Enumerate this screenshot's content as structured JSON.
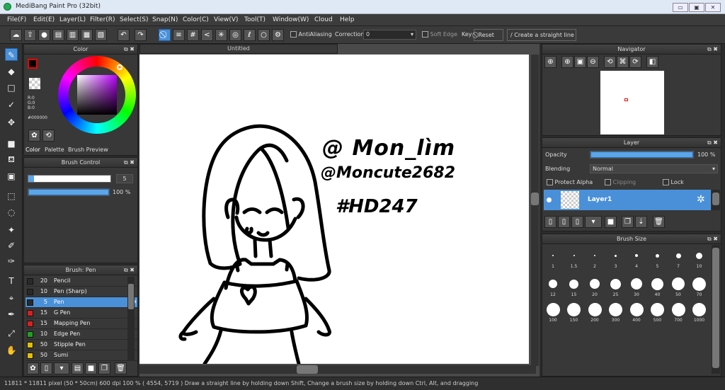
{
  "window": {
    "title": "MediBang Paint Pro (32bit)"
  },
  "menu": [
    "File(F)",
    "Edit(E)",
    "Layer(L)",
    "Filter(R)",
    "Select(S)",
    "Snap(N)",
    "Color(C)",
    "View(V)",
    "Tool(T)",
    "Window(W)",
    "Cloud",
    "Help"
  ],
  "toolbar": {
    "antialiasing": "AntiAliasing",
    "correction_label": "Correction",
    "correction_value": "0",
    "soft_edge": "Soft Edge",
    "key": "Key",
    "reset": "Reset",
    "straight_line": "Create a straight line"
  },
  "color_panel": {
    "title": "Color",
    "r": "R:0",
    "g": "G:0",
    "b": "B:0",
    "hex": "#000000",
    "tabs": [
      "Color",
      "Palette",
      "Brush Preview"
    ],
    "fg_color": "#000000",
    "accent": "#4a90d9"
  },
  "brush_control": {
    "title": "Brush Control",
    "size": "5",
    "opacity": "100 %",
    "opacity_fraction": 1.0
  },
  "brush_panel": {
    "title": "Brush: Pen",
    "items": [
      {
        "size": "20",
        "name": "Pencil",
        "color": "#2a2a2a"
      },
      {
        "size": "10",
        "name": "Pen (Sharp)",
        "color": "#2a2a2a"
      },
      {
        "size": "5",
        "name": "Pen",
        "color": "#2a2a2a",
        "selected": true
      },
      {
        "size": "15",
        "name": "G Pen",
        "color": "#d82020"
      },
      {
        "size": "15",
        "name": "Mapping Pen",
        "color": "#d82020"
      },
      {
        "size": "10",
        "name": "Edge Pen",
        "color": "#20a020"
      },
      {
        "size": "50",
        "name": "Stipple Pen",
        "color": "#e0c000"
      },
      {
        "size": "50",
        "name": "Sumi",
        "color": "#e0c000"
      }
    ]
  },
  "canvas": {
    "tab": "Untitled",
    "text1": "@ Mon_lìm",
    "text2": "@Moncute2682",
    "text3": "#HD247"
  },
  "navigator": {
    "title": "Navigator"
  },
  "layer_panel": {
    "title": "Layer",
    "opacity_label": "Opacity",
    "opacity_value": "100 %",
    "opacity_fraction": 1.0,
    "blending_label": "Blending",
    "blending_value": "Normal",
    "protect_alpha": "Protect Alpha",
    "clipping": "Clipping",
    "lock": "Lock",
    "layer_name": "Layer1"
  },
  "brush_size": {
    "title": "Brush Size",
    "rows": [
      [
        "1",
        "1.5",
        "2",
        "3",
        "4",
        "5",
        "7",
        "10"
      ],
      [
        "12",
        "15",
        "20",
        "25",
        "30",
        "40",
        "50",
        "70"
      ],
      [
        "100",
        "150",
        "200",
        "300",
        "400",
        "500",
        "700",
        "1000"
      ]
    ]
  },
  "status": {
    "text": "11811 * 11811 pixel  (50 * 50cm)  600 dpi  100 %  ( 4554, 5719 )  Draw a straight line by holding down Shift, Change a brush size by holding down Ctrl, Alt, and dragging"
  }
}
